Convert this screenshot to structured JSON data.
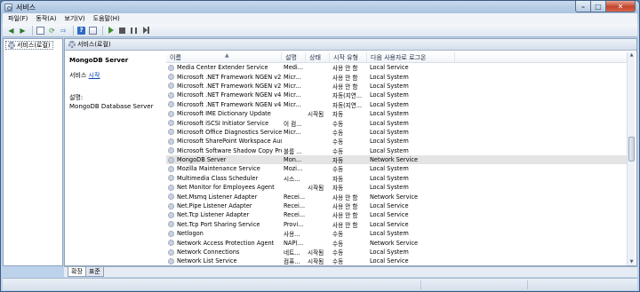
{
  "window": {
    "title": "서비스"
  },
  "menu": [
    {
      "label": "파일(F)"
    },
    {
      "label": "동작(A)"
    },
    {
      "label": "보기(V)"
    },
    {
      "label": "도움말(H)"
    }
  ],
  "tree": {
    "root_label": "서비스(로컬)"
  },
  "pane_header": {
    "title": "서비스(로컬)"
  },
  "detail": {
    "service_name": "MongoDB Server",
    "action_prefix": "서비스 ",
    "action_link": "시작",
    "desc_label": "설명:",
    "desc_text": "MongoDB Database Server"
  },
  "columns": {
    "name": "이름",
    "desc": "설명",
    "status": "상태",
    "startup": "시작 유형",
    "logon": "다음 사용자로 로그온"
  },
  "services": [
    {
      "name": "Media Center Extender Service",
      "desc": "Medi...",
      "status": "",
      "startup": "사용 안 함",
      "logon": "Local Service"
    },
    {
      "name": "Microsoft .NET Framework NGEN v2.0....",
      "desc": "Micr...",
      "status": "",
      "startup": "사용 안 함",
      "logon": "Local System"
    },
    {
      "name": "Microsoft .NET Framework NGEN v2.0....",
      "desc": "Micr...",
      "status": "",
      "startup": "사용 안 함",
      "logon": "Local System"
    },
    {
      "name": "Microsoft .NET Framework NGEN v4.0....",
      "desc": "Micr...",
      "status": "",
      "startup": "자동(지연...",
      "logon": "Local System"
    },
    {
      "name": "Microsoft .NET Framework NGEN v4.0....",
      "desc": "Micr...",
      "status": "",
      "startup": "자동(지연...",
      "logon": "Local System"
    },
    {
      "name": "Microsoft IME Dictionary Update",
      "desc": "",
      "status": "시작됨",
      "startup": "자동",
      "logon": "Local System"
    },
    {
      "name": "Microsoft iSCSI Initiator Service",
      "desc": "이 컴...",
      "status": "",
      "startup": "수동",
      "logon": "Local System"
    },
    {
      "name": "Microsoft Office Diagnostics Service",
      "desc": "Micr...",
      "status": "",
      "startup": "수동",
      "logon": "Local System"
    },
    {
      "name": "Microsoft SharePoint Workspace Audi...",
      "desc": "",
      "status": "",
      "startup": "수동",
      "logon": "Local System"
    },
    {
      "name": "Microsoft Software Shadow Copy Pro...",
      "desc": "볼륨 ...",
      "status": "",
      "startup": "수동",
      "logon": "Local System"
    },
    {
      "name": "MongoDB Server",
      "desc": "Mon...",
      "status": "",
      "startup": "자동",
      "logon": "Network Service",
      "selected": true
    },
    {
      "name": "Mozilla Maintenance Service",
      "desc": "Mozi...",
      "status": "",
      "startup": "수동",
      "logon": "Local System"
    },
    {
      "name": "Multimedia Class Scheduler",
      "desc": "시스...",
      "status": "",
      "startup": "자동",
      "logon": "Local System"
    },
    {
      "name": "Net Monitor for Employees Agent",
      "desc": "",
      "status": "시작됨",
      "startup": "자동",
      "logon": "Local System"
    },
    {
      "name": "Net.Msmq Listener Adapter",
      "desc": "Recei...",
      "status": "",
      "startup": "사용 안 함",
      "logon": "Network Service"
    },
    {
      "name": "Net.Pipe Listener Adapter",
      "desc": "Recei...",
      "status": "",
      "startup": "사용 안 함",
      "logon": "Local Service"
    },
    {
      "name": "Net.Tcp Listener Adapter",
      "desc": "Recei...",
      "status": "",
      "startup": "사용 안 함",
      "logon": "Local Service"
    },
    {
      "name": "Net.Tcp Port Sharing Service",
      "desc": "Provi...",
      "status": "",
      "startup": "사용 안 함",
      "logon": "Local Service"
    },
    {
      "name": "Netlogon",
      "desc": "사용...",
      "status": "",
      "startup": "수동",
      "logon": "Local System"
    },
    {
      "name": "Network Access Protection Agent",
      "desc": "NAP(...",
      "status": "",
      "startup": "수동",
      "logon": "Network Service"
    },
    {
      "name": "Network Connections",
      "desc": "네트...",
      "status": "시작됨",
      "startup": "수동",
      "logon": "Local System"
    },
    {
      "name": "Network List Service",
      "desc": "컴퓨...",
      "status": "시작됨",
      "startup": "수동",
      "logon": "Local Service"
    }
  ],
  "tabs": [
    {
      "label": "확장"
    },
    {
      "label": "표준"
    }
  ]
}
